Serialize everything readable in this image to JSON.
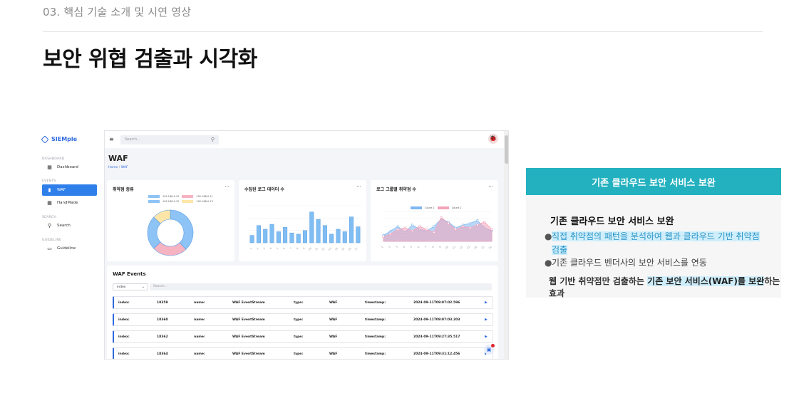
{
  "header": {
    "section_label": "03. 핵심 기술 소개 및 시연 영상",
    "title": "보안 위협 검출과 시각화"
  },
  "app": {
    "brand": "SIEMple",
    "nav": {
      "group_dashboard": "DASHBOARD",
      "dashboard": "Dashboard",
      "group_events": "EVENTS",
      "waf": "WAF",
      "handmade": "HandMade",
      "group_search": "SEARCH",
      "search": "Search",
      "group_guideline": "GUIDELINE",
      "guideline": "Guideline"
    },
    "search_placeholder": "Search...",
    "page_title": "WAF",
    "breadcrumb_home": "Home",
    "breadcrumb_sep": "/",
    "breadcrumb_current": "WAF",
    "cards": {
      "vuln_types_title": "취약점 종류",
      "collected_logs_title": "수집된 로그 데이터 수",
      "group_vuln_title": "로그 그룹별 취약점 수",
      "more": "···",
      "donut_legend": [
        "192.168.0.10",
        "192.168.0.11",
        "192.168.0.12",
        "192.168.0.13"
      ],
      "area_legend": [
        "Count 1",
        "Count 2"
      ]
    },
    "events": {
      "title": "WAF Events",
      "select_value": "index",
      "search_placeholder": "Search...",
      "labels": {
        "index": "index:",
        "name": "name:",
        "type": "type:",
        "timestamp": "timestamp:"
      },
      "rows": [
        {
          "index": "18359",
          "name": "WAF EventStream",
          "type": "WAF",
          "timestamp": "2024-09-11T09:07:02.596"
        },
        {
          "index": "18360",
          "name": "WAF EventStream",
          "type": "WAF",
          "timestamp": "2024-09-11T09:07:03.203"
        },
        {
          "index": "18362",
          "name": "WAF EventStream",
          "type": "WAF",
          "timestamp": "2024-09-11T09:27:35.517"
        },
        {
          "index": "18364",
          "name": "WAF EventStream",
          "type": "WAF",
          "timestamp": "2024-09-11T09:31:12.456"
        }
      ]
    }
  },
  "panel": {
    "header": "기존 클라우드 보안 서비스 보완",
    "subtitle": "기존 클라우드 보안 서비스 보완",
    "bullet1_line1": "직접 취약점의 패턴을 분석하여 웹과 클라우드 기반 취약점",
    "bullet1_line2": "검출",
    "bullet2": "기존 클라우드 벤더사의 보안 서비스를 연동",
    "summary_pre": "웹 기반 취약점만 검출하는 ",
    "summary_hl": "기존 보안 서비스(WAF)를 보완",
    "summary_post": "하는 효과"
  },
  "chart_data": [
    {
      "type": "pie",
      "title": "취약점 종류",
      "categories": [
        "192.168.0.10",
        "192.168.0.11",
        "192.168.0.12",
        "192.168.0.13"
      ],
      "values": [
        38,
        25,
        24,
        13
      ],
      "colors": [
        "#8ec3f5",
        "#f6b3c2",
        "#8ec3f5",
        "#fde6a8"
      ]
    },
    {
      "type": "bar",
      "title": "수집된 로그 데이터 수",
      "categories": [
        "1",
        "2",
        "3",
        "4",
        "5",
        "6",
        "7",
        "8",
        "9",
        "10",
        "11",
        "12",
        "13",
        "14",
        "15",
        "16",
        "17"
      ],
      "values": [
        12,
        28,
        22,
        30,
        18,
        25,
        16,
        14,
        20,
        50,
        38,
        28,
        14,
        22,
        18,
        42,
        26
      ],
      "ylim": [
        0,
        60
      ],
      "color": "#7fbdf2"
    },
    {
      "type": "area",
      "title": "로그 그룹별 취약점 수",
      "categories": [
        "1",
        "2",
        "3",
        "4",
        "5",
        "6",
        "7",
        "8",
        "9",
        "10",
        "11",
        "12",
        "13",
        "14",
        "15",
        "16"
      ],
      "series": [
        {
          "name": "Count 1",
          "values": [
            8,
            14,
            20,
            12,
            22,
            16,
            14,
            20,
            30,
            26,
            18,
            22,
            24,
            28,
            18,
            14
          ],
          "color": "#7fb7f0"
        },
        {
          "name": "Count 2",
          "values": [
            6,
            10,
            16,
            18,
            14,
            20,
            16,
            12,
            32,
            24,
            16,
            20,
            18,
            22,
            26,
            16
          ],
          "color": "#f3a3b9"
        }
      ],
      "ylim": [
        0,
        40
      ]
    }
  ]
}
